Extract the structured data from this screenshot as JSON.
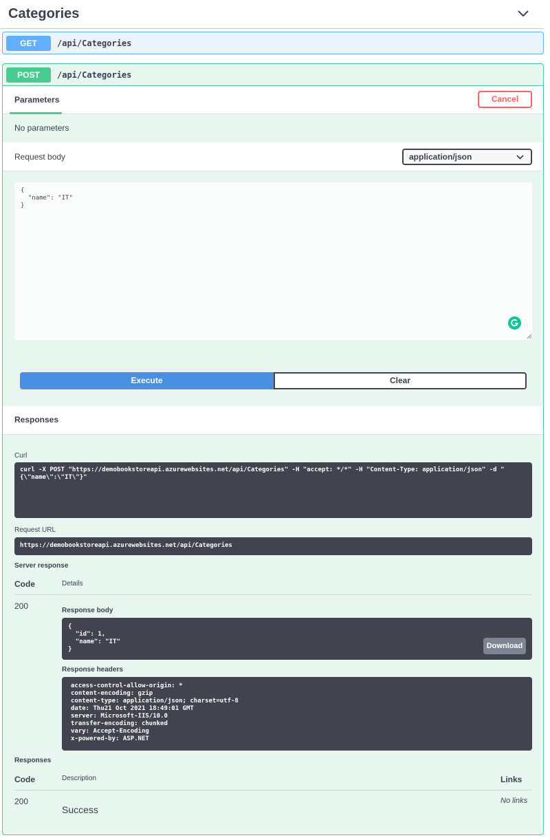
{
  "tag": {
    "title": "Categories"
  },
  "get_op": {
    "method": "GET",
    "path": "/api/Categories"
  },
  "post_op": {
    "method": "POST",
    "path": "/api/Categories",
    "parameters_tab": "Parameters",
    "cancel_label": "Cancel",
    "no_parameters": "No parameters",
    "request_body_label": "Request body",
    "content_type": "application/json",
    "request_body_text": "{\n  \"name\": \"IT\"\n}",
    "execute_label": "Execute",
    "clear_label": "Clear"
  },
  "responses": {
    "title": "Responses",
    "curl_label": "Curl",
    "curl_text": "curl -X POST \"https://demobookstoreapi.azurewebsites.net/api/Categories\" -H \"accept: */*\" -H \"Content-Type: application/json\" -d \"\n{\\\"name\\\":\\\"IT\\\"}\"",
    "request_url_label": "Request URL",
    "request_url": "https://demobookstoreapi.azurewebsites.net/api/Categories",
    "server_response_label": "Server response",
    "code_header": "Code",
    "details_header": "Details",
    "code": "200",
    "response_body_label": "Response body",
    "response_body_text": "{\n  \"id\": 1,\n  \"name\": \"IT\"\n}",
    "download_label": "Download",
    "response_headers_label": "Response headers",
    "response_headers_text": "access-control-allow-origin: *\ncontent-encoding: gzip\ncontent-type: application/json; charset=utf-8\ndate: Thu21 Oct 2021 18:49:01 GMT\nserver: Microsoft-IIS/10.0\ntransfer-encoding: chunked\nvary: Accept-Encoding\nx-powered-by: ASP.NET"
  },
  "responses_table": {
    "title": "Responses",
    "code_header": "Code",
    "description_header": "Description",
    "links_header": "Links",
    "rows": [
      {
        "code": "200",
        "description": "Success",
        "links": "No links"
      }
    ]
  },
  "colors": {
    "get": "#61affe",
    "post": "#49cc90",
    "execute": "#4990e2",
    "cancel": "#ff6060",
    "dark_block": "#41444e"
  }
}
